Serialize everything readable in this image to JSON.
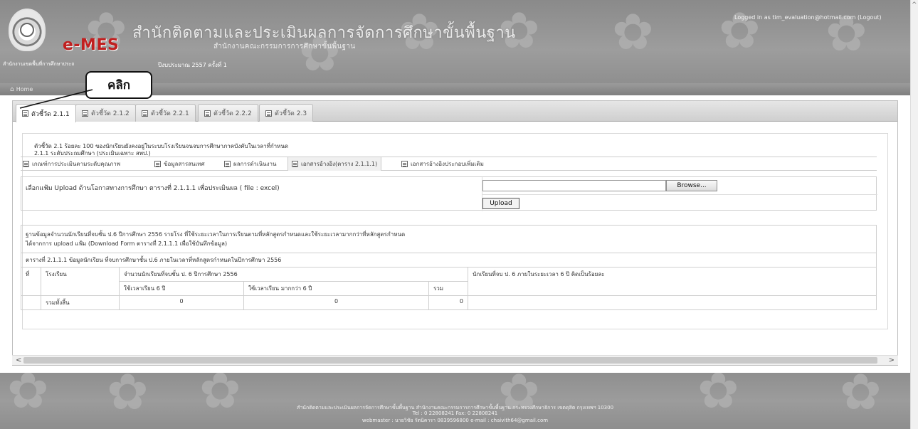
{
  "header": {
    "brand": "e-MES",
    "agency_title": "สำนักติดตามและประเมินผลการจัดการศึกษาขั้นพื้นฐาน",
    "agency_subtitle": "สำนักงานคณะกรรมการการศึกษาขั้นพื้นฐาน",
    "agency_left": "สำนักงานเขตพื้นที่การศึกษาประถ",
    "budget_year": "ปีงบประมาณ 2557 ครั้งที่ 1",
    "login_info": "Logged in as tim_evaluation@hotmail.com (Logout)"
  },
  "callout": {
    "text": "คลิก"
  },
  "breadcrumb": {
    "home": "Home",
    "home_icon": "home-icon"
  },
  "tabs": [
    {
      "label": "ตัวชี้วัด 2.1.1",
      "active": true
    },
    {
      "label": "ตัวชี้วัด 2.1.2",
      "active": false
    },
    {
      "label": "ตัวชี้วัด 2.2.1",
      "active": false
    },
    {
      "label": "ตัวชี้วัด 2.2.2",
      "active": false
    },
    {
      "label": "ตัวชี้วัด 2.3",
      "active": false
    }
  ],
  "indicator": {
    "line1": "ตัวชี้วัด 2.1 ร้อยละ 100 ของนักเรียนยังคงอยู่ในระบบโรงเรียนจนจบการศึกษาภาคบังคับในเวลาที่กำหนด",
    "line2": "2.1.1 ระดับประถมศึกษา (ประเมินเฉพาะ สพป.)"
  },
  "subtabs": [
    {
      "label": "เกณฑ์การประเมินตามระดับคุณภาพ",
      "active": false
    },
    {
      "label": "ข้อมูลสารสนเทศ",
      "active": false
    },
    {
      "label": "ผลการดำเนินงาน",
      "active": false
    },
    {
      "label": "เอกสารอ้างอิง(ตาราง 2.1.1.1)",
      "active": true
    },
    {
      "label": "เอกสารอ้างอิงประกอบเพิ่มเติม",
      "active": false
    }
  ],
  "upload": {
    "label": "เลือกแฟ้ม Upload ด้านโอกาสทางการศึกษา ตารางที่ 2.1.1.1 เพื่อประเมินผล ( file : excel)",
    "browse": "Browse...",
    "upload_button": "Upload"
  },
  "table": {
    "intro_line1": "ฐานข้อมูลจำนวนนักเรียนที่จบชั้น ป.6 ปีการศึกษา 2556 รายโรง ที่ใช้ระยะเวลาในการเรียนตามที่หลักสูตรกำหนดและใช้ระยะเวลามากกว่าที่หลักสูตรกำหนด",
    "intro_line2": "ได้จากการ upload แฟ้ม      (Download Form ตารางที่ 2.1.1.1 เพื่อใช้บันทึกข้อมูล)",
    "caption": "ตารางที่ 2.1.1.1 ข้อมูลนักเรียน ที่จบการศึกษาชั้น ป.6 ภายในเวลาที่หลักสูตรกำหนดในปีการศึกษา 2556",
    "col_no": "ที่",
    "col_school": "โรงเรียน",
    "col_group": "จำนวนนักเรียนที่จบชั้น ป. 6 ปีการศึกษา 2556",
    "col_pct": "นักเรียนที่จบ ป. 6 ภายในระยะเวลา 6 ปี คิดเป็นร้อยละ",
    "sub_6yr": "ใช้เวลาเรียน 6 ปี",
    "sub_more": "ใช้เวลาเรียน มากกว่า 6 ปี",
    "sub_total": "รวม",
    "total_label": "รวมทั้งสิ้น",
    "total_6yr": "0",
    "total_more": "0",
    "total_sum": "0"
  },
  "footer": {
    "line1": "สำนักติดตามและประเมินผลการจัดการศึกษาขั้นพื้นฐาน สำนักงานคณะกรรมการการศึกษาขั้นพื้นฐาน กระทรวงศึกษาธิการ เขตดุสิต กรุงเทพฯ 10300",
    "line2": "Tel : 0 22808241 Fax: 0 22808241",
    "line3": "webmaster : นายวิชัย รัตนิคารา 0839596800 e-mail : chaivith64@gmail.com"
  }
}
